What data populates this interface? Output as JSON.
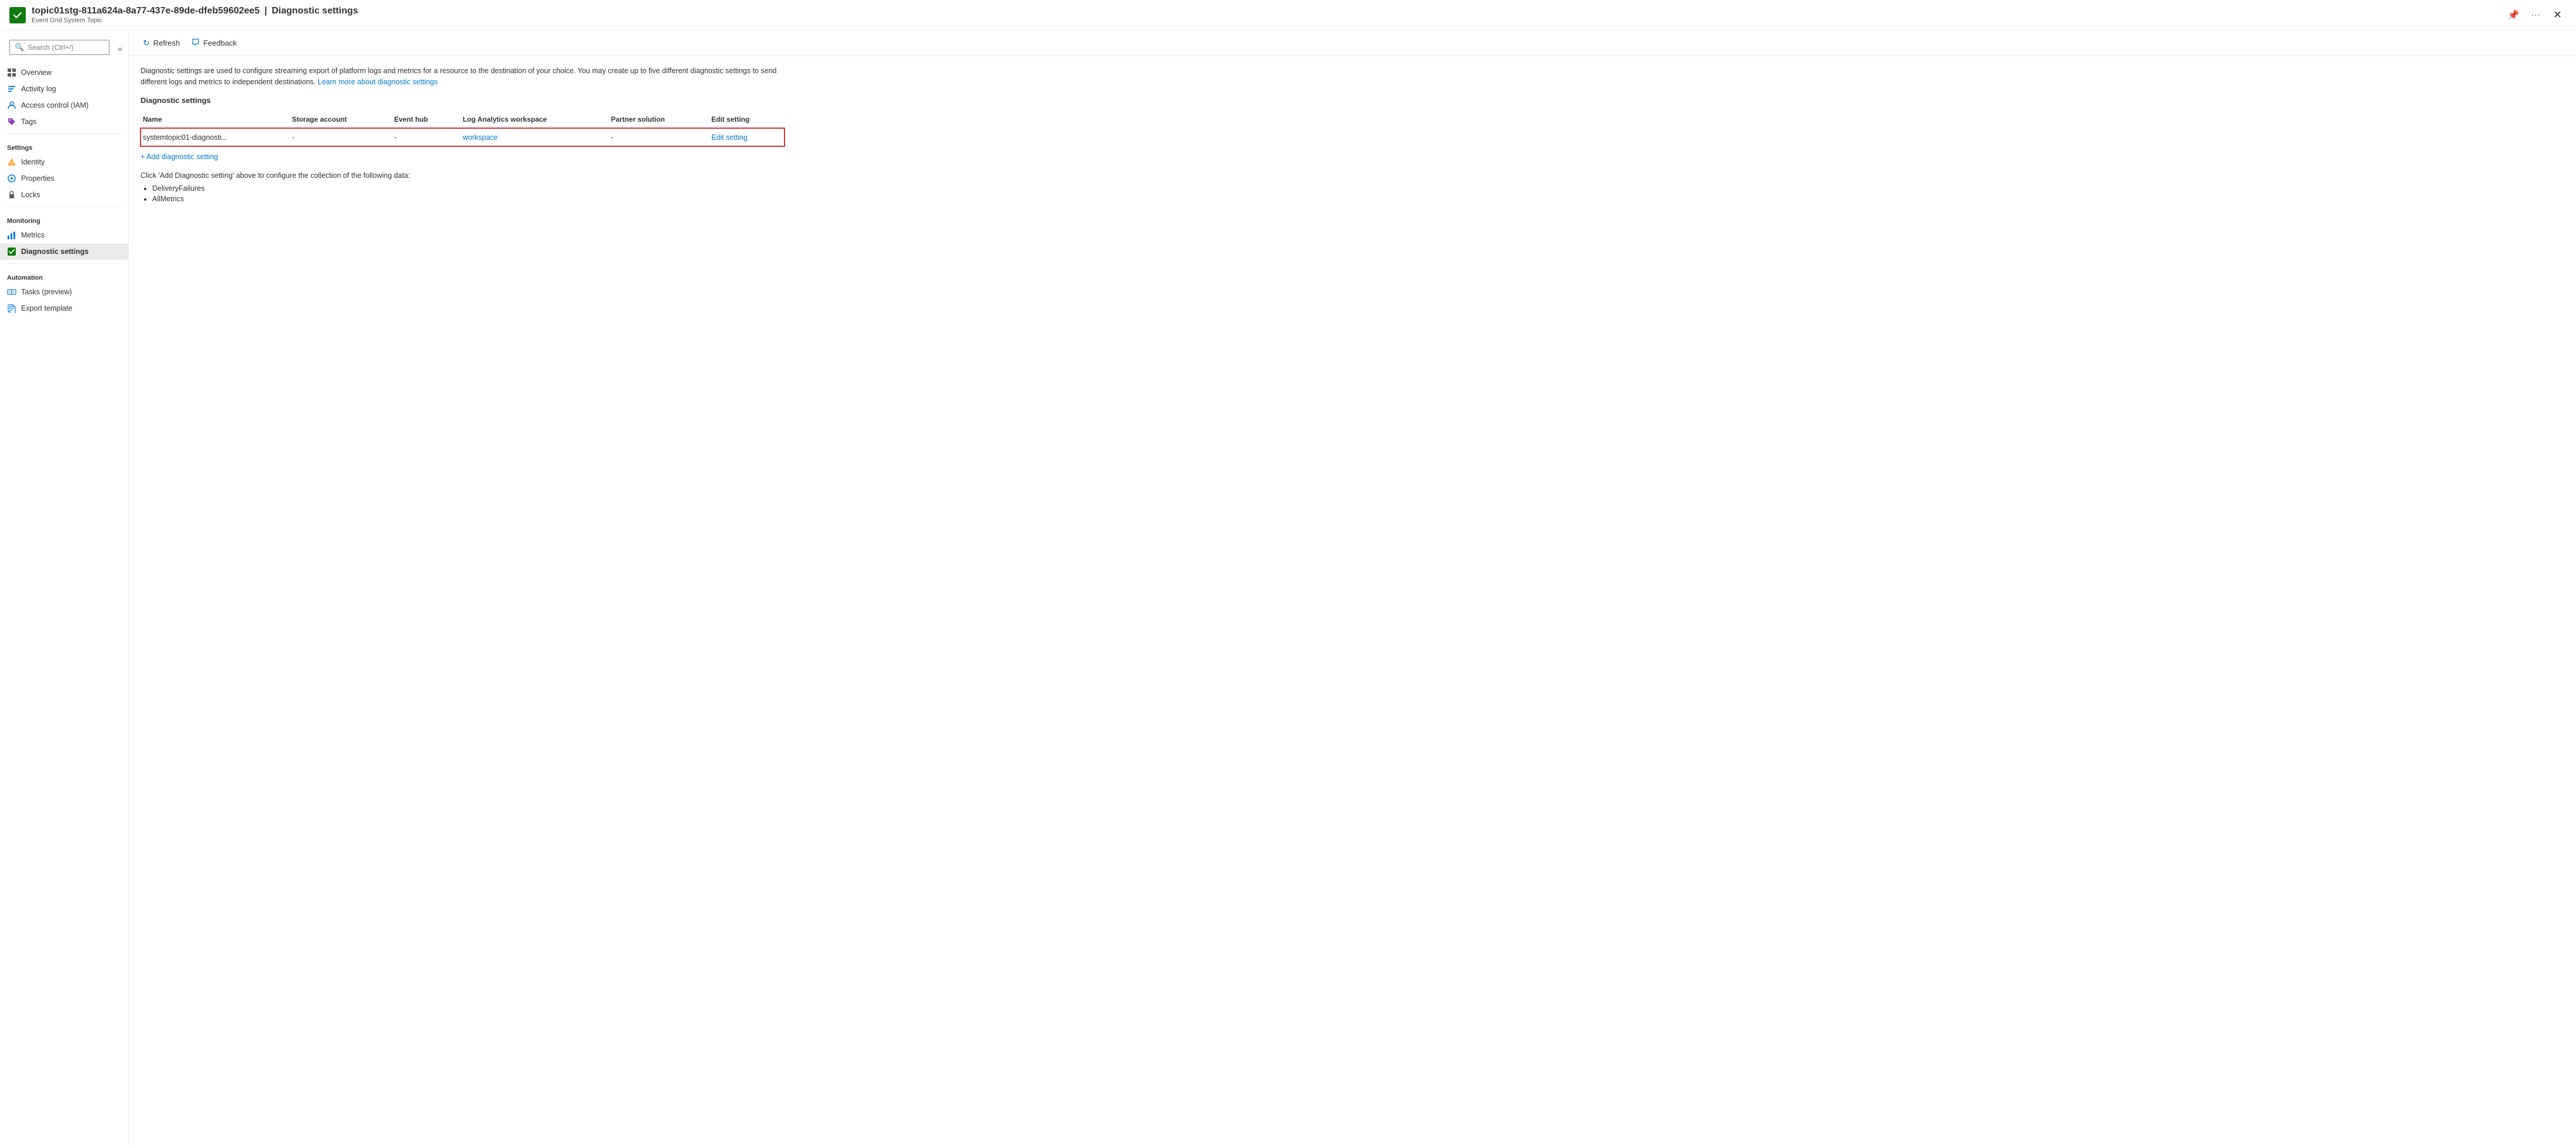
{
  "header": {
    "resource_name": "topic01stg-811a624a-8a77-437e-89de-dfeb59602ee5",
    "separator": "|",
    "page_title": "Diagnostic settings",
    "subtitle": "Event Grid System Topic",
    "pin_tooltip": "Pin",
    "more_tooltip": "More",
    "close_tooltip": "Close"
  },
  "sidebar": {
    "search_placeholder": "Search (Ctrl+/)",
    "collapse_label": "Collapse",
    "items": [
      {
        "id": "overview",
        "label": "Overview",
        "icon": "overview-icon"
      },
      {
        "id": "activity-log",
        "label": "Activity log",
        "icon": "activity-icon"
      },
      {
        "id": "access-control",
        "label": "Access control (IAM)",
        "icon": "iam-icon"
      },
      {
        "id": "tags",
        "label": "Tags",
        "icon": "tags-icon"
      }
    ],
    "settings_section": "Settings",
    "settings_items": [
      {
        "id": "identity",
        "label": "Identity",
        "icon": "identity-icon"
      },
      {
        "id": "properties",
        "label": "Properties",
        "icon": "properties-icon"
      },
      {
        "id": "locks",
        "label": "Locks",
        "icon": "locks-icon"
      }
    ],
    "monitoring_section": "Monitoring",
    "monitoring_items": [
      {
        "id": "metrics",
        "label": "Metrics",
        "icon": "metrics-icon"
      },
      {
        "id": "diagnostic-settings",
        "label": "Diagnostic settings",
        "icon": "diagnostic-icon",
        "active": true
      }
    ],
    "automation_section": "Automation",
    "automation_items": [
      {
        "id": "tasks",
        "label": "Tasks (preview)",
        "icon": "tasks-icon"
      },
      {
        "id": "export-template",
        "label": "Export template",
        "icon": "export-icon"
      }
    ]
  },
  "toolbar": {
    "refresh_label": "Refresh",
    "feedback_label": "Feedback"
  },
  "content": {
    "description": "Diagnostic settings are used to configure streaming export of platform logs and metrics for a resource to the destination of your choice. You may create up to five different diagnostic settings to send different logs and metrics to independent destinations.",
    "learn_more_text": "Learn more about diagnostic settings",
    "learn_more_url": "#",
    "section_title": "Diagnostic settings",
    "table_headers": [
      "Name",
      "Storage account",
      "Event hub",
      "Log Analytics workspace",
      "Partner solution",
      "Edit setting"
    ],
    "table_rows": [
      {
        "name": "systemtopic01-diagnosti...",
        "storage_account": "-",
        "event_hub": "-",
        "log_analytics": "workspace",
        "partner_solution": "-",
        "edit_setting": "Edit setting"
      }
    ],
    "add_setting_label": "+ Add diagnostic setting",
    "click_info": "Click 'Add Diagnostic setting' above to configure the collection of the following data:",
    "bullet_items": [
      "DeliveryFailures",
      "AllMetrics"
    ]
  }
}
